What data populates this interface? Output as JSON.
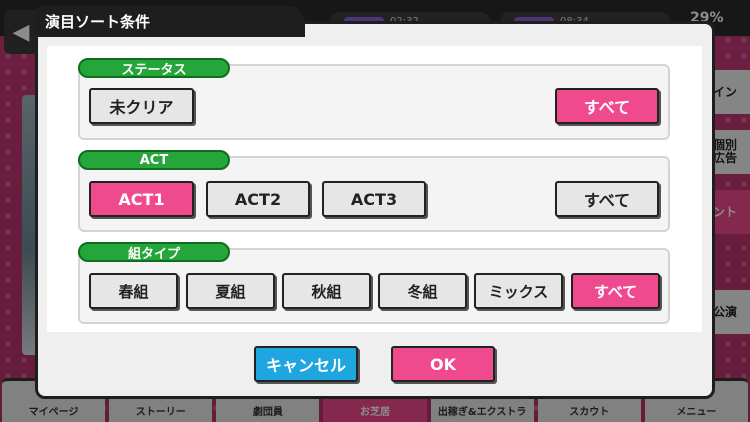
{
  "background": {
    "stat1": "02:32",
    "stat2": "08:34",
    "percent": "29%",
    "side_buttons": [
      "イン",
      "個別\n広告",
      "ント",
      "公演"
    ],
    "bottom_tabs": [
      "マイページ",
      "ストーリー",
      "劇団員",
      "お芝居",
      "出稼ぎ&エクストラ",
      "スカウト",
      "メニュー"
    ]
  },
  "modal": {
    "title": "演目ソート条件",
    "sections": [
      {
        "label": "ステータス",
        "options": [
          "未クリア"
        ],
        "all_label": "すべて"
      },
      {
        "label": "ACT",
        "options": [
          "ACT1",
          "ACT2",
          "ACT3"
        ],
        "all_label": "すべて"
      },
      {
        "label": "組タイプ",
        "options": [
          "春組",
          "夏組",
          "秋組",
          "冬組",
          "ミックス"
        ],
        "all_label": "すべて"
      }
    ],
    "cancel_label": "キャンセル",
    "ok_label": "OK"
  },
  "colors": {
    "selected": "#f04a8e",
    "unselected": "#e6e6e6",
    "section_label": "#26a63a",
    "cancel": "#1fa6e0",
    "ok": "#f04a8e"
  }
}
